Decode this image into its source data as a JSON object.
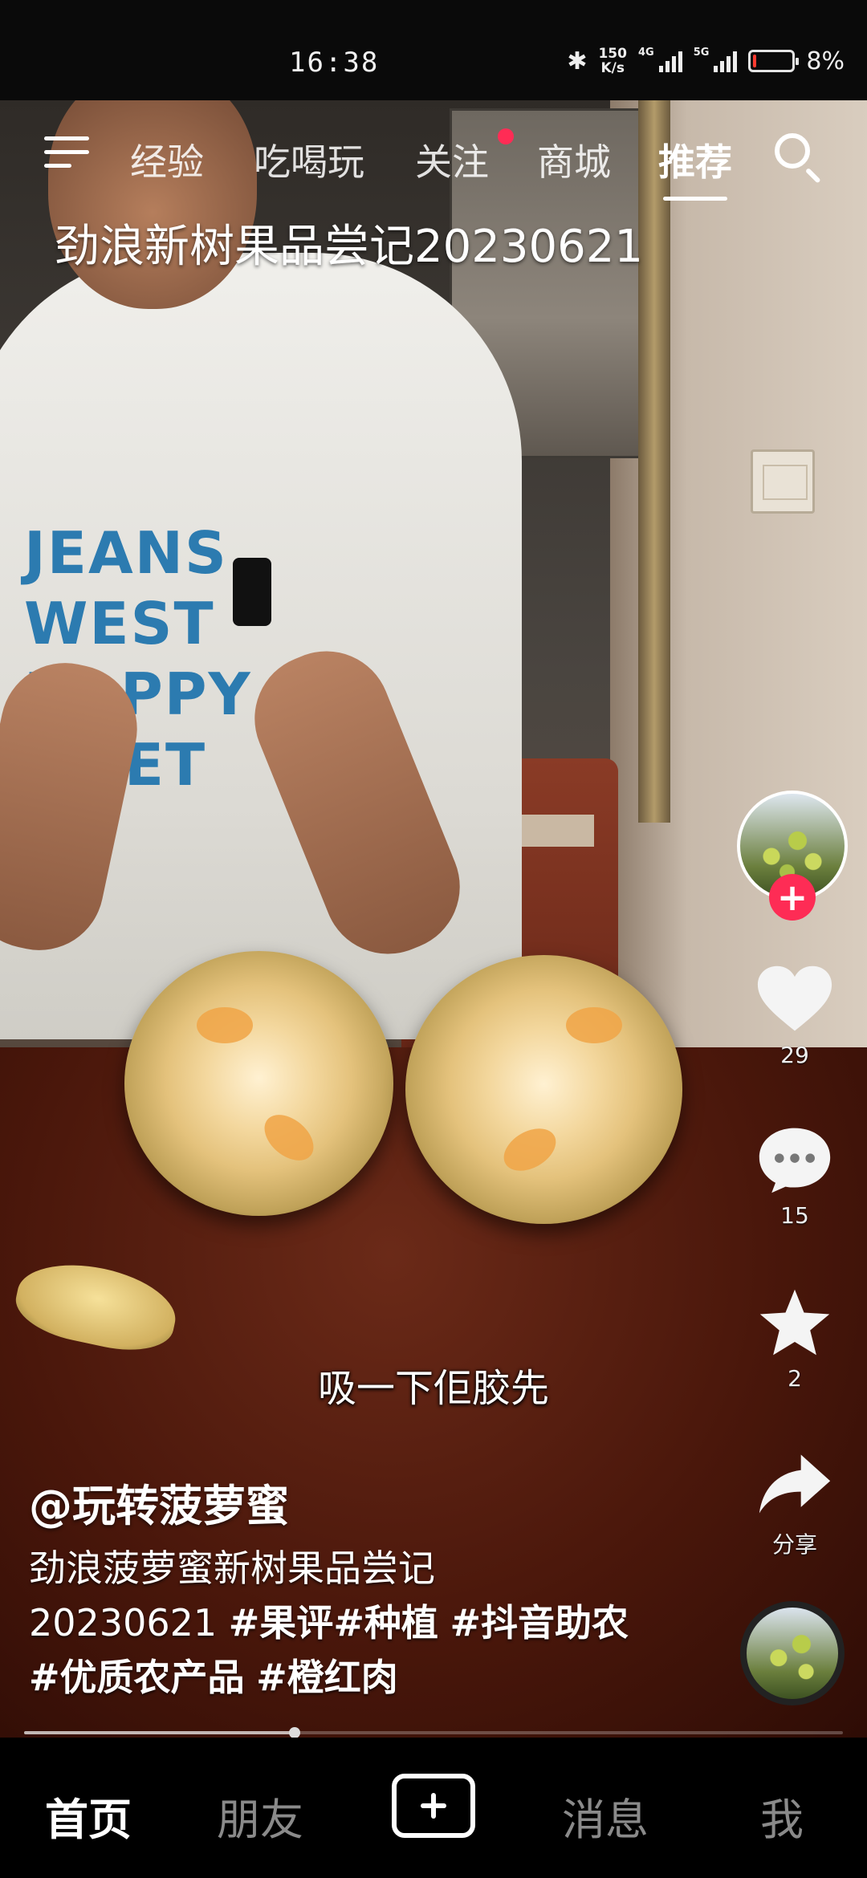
{
  "status_bar": {
    "time": "16:38",
    "net_speed_value": "150",
    "net_speed_unit": "K/s",
    "signal1_label": "4G",
    "signal2_label": "5G",
    "battery": "8%",
    "battery_level": 0.08
  },
  "top_nav": {
    "tabs": [
      "经验",
      "吃喝玩",
      "关注",
      "商城",
      "推荐"
    ],
    "active_tab": "推荐"
  },
  "video": {
    "title_overlay": "劲浪新树果品尝记20230621",
    "shirt_print": [
      "JEANS",
      "WEST",
      "HAPPY",
      "MEET"
    ],
    "subtitle": "吸一下佢胶先",
    "progress": 0.33
  },
  "actions": {
    "likes": "29",
    "comments": "15",
    "favorites": "2",
    "share_label": "分享"
  },
  "caption": {
    "author": "@玩转菠萝蜜",
    "text": "劲浪菠萝蜜新树果品尝记",
    "date": "20230621",
    "tags": [
      "#果评",
      "#种植",
      "#抖音助农",
      "#优质农产品",
      "#橙红肉"
    ]
  },
  "bottom_nav": {
    "items": [
      "首页",
      "朋友",
      "消息",
      "我"
    ],
    "active": "首页"
  },
  "colors": {
    "accent": "#fe2c55",
    "battery_low": "#ff3b30"
  }
}
